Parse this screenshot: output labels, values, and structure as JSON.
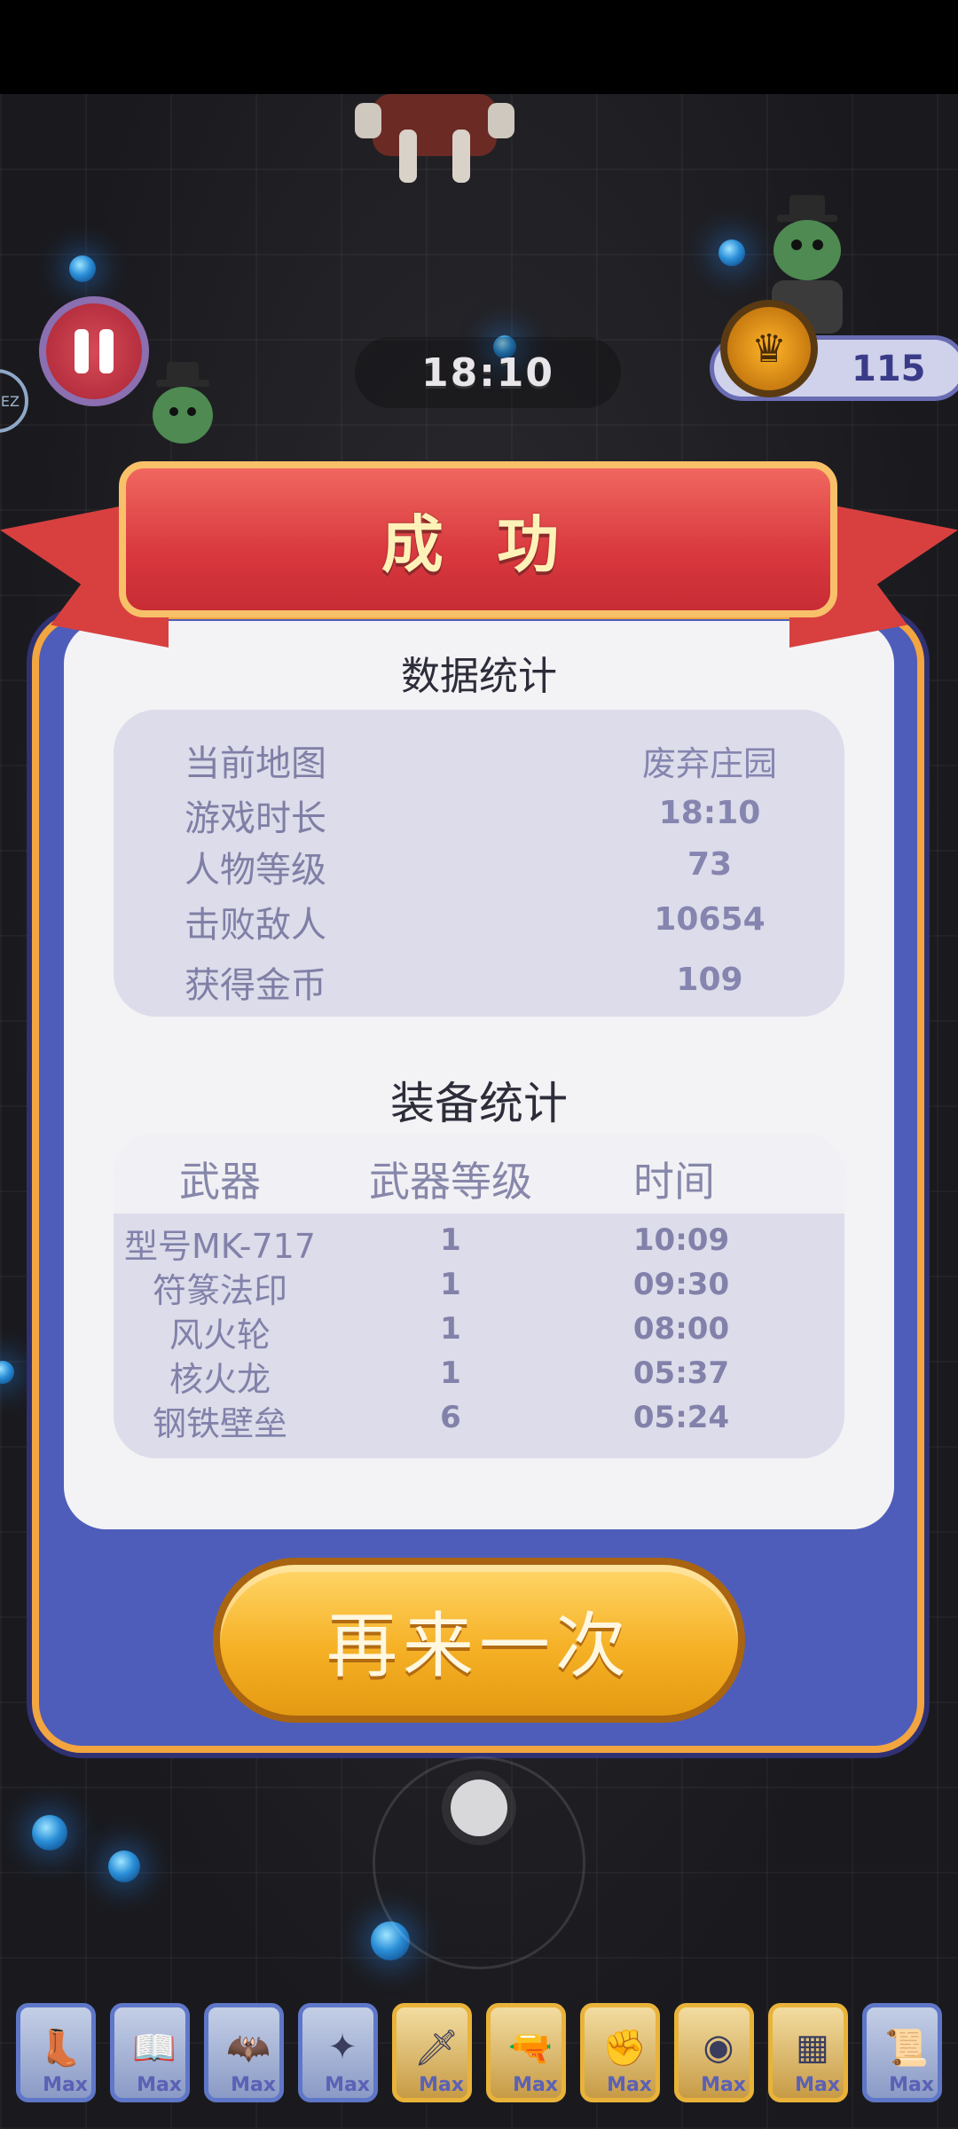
{
  "hud": {
    "timer": "18:10",
    "coins": "115",
    "side_chip": "EZ"
  },
  "dialog": {
    "title": "成 功",
    "stats_title": "数据统计",
    "stats": [
      {
        "label": "当前地图",
        "value": "废弃庄园"
      },
      {
        "label": "游戏时长",
        "value": "18:10"
      },
      {
        "label": "人物等级",
        "value": "73"
      },
      {
        "label": "击败敌人",
        "value": "10654"
      },
      {
        "label": "获得金币",
        "value": "109"
      }
    ],
    "equip_title": "装备统计",
    "equip_headers": [
      "武器",
      "武器等级",
      "时间"
    ],
    "equipment": [
      {
        "weapon": "型号MK-717",
        "level": "1",
        "time": "10:09"
      },
      {
        "weapon": "符篆法印",
        "level": "1",
        "time": "09:30"
      },
      {
        "weapon": "风火轮",
        "level": "1",
        "time": "08:00"
      },
      {
        "weapon": "核火龙",
        "level": "1",
        "time": "05:37"
      },
      {
        "weapon": "钢铁壁垒",
        "level": "6",
        "time": "05:24"
      }
    ],
    "again_button": "再来一次"
  },
  "skills": [
    {
      "icon": "boot-icon",
      "label": "Max"
    },
    {
      "icon": "book-icon",
      "label": "Max"
    },
    {
      "icon": "bat-icon",
      "label": "Max"
    },
    {
      "icon": "wings-icon",
      "label": "Max"
    },
    {
      "icon": "sword-icon",
      "label": "Max"
    },
    {
      "icon": "blaster-icon",
      "label": "Max"
    },
    {
      "icon": "glove-icon",
      "label": "Max"
    },
    {
      "icon": "orb-icon",
      "label": "Max"
    },
    {
      "icon": "brick-icon",
      "label": "Max"
    },
    {
      "icon": "scroll-icon",
      "label": "Max"
    }
  ],
  "colors": {
    "panel": "#4f5dba",
    "ribbon": "#d9383e",
    "button": "#f6b126",
    "text_muted": "#8181aa"
  }
}
